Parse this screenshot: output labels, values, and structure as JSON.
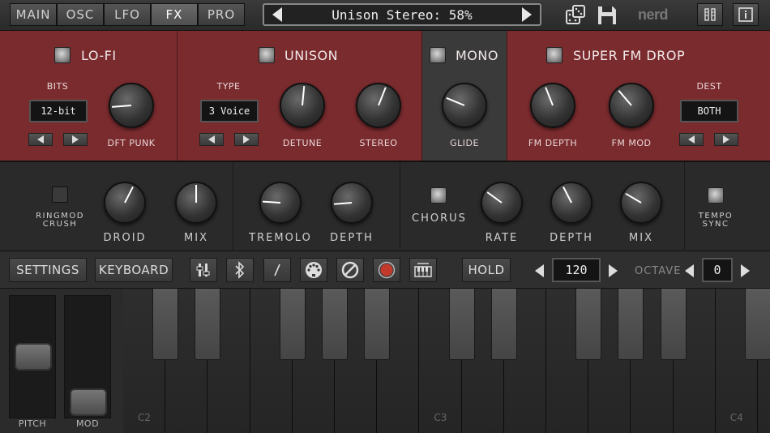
{
  "tabs": [
    {
      "label": "MAIN"
    },
    {
      "label": "OSC"
    },
    {
      "label": "LFO"
    },
    {
      "label": "FX",
      "active": true
    },
    {
      "label": "PRO"
    }
  ],
  "preset": {
    "name": "Unison Stereo: 58%"
  },
  "brand": "nerd",
  "icons": {
    "dice": "dice-icon",
    "save": "floppy-disk-icon",
    "menu": "sliders-menu-icon",
    "info": "info-icon"
  },
  "lofi": {
    "title": "LO-FI",
    "bits_label": "BITS",
    "bits_value": "12-bit",
    "knob_label": "DFT PUNK",
    "knob_value": 0.15
  },
  "unison": {
    "title": "UNISON",
    "type_label": "TYPE",
    "type_value": "3 Voice",
    "detune_label": "DETUNE",
    "detune_value": 0.52,
    "stereo_label": "STEREO",
    "stereo_value": 0.58
  },
  "mono": {
    "title": "MONO",
    "glide_label": "GLIDE",
    "glide_value": 0.25
  },
  "superfm": {
    "title": "SUPER FM DROP",
    "fm_depth_label": "FM DEPTH",
    "fm_depth_value": 0.42,
    "fm_mod_label": "FM MOD",
    "fm_mod_value": 0.35,
    "dest_label": "DEST",
    "dest_value": "BOTH"
  },
  "ringmod": {
    "label_line1": "RINGMOD",
    "label_line2": "CRUSH",
    "droid_label": "DROID",
    "droid_value": 0.6,
    "mix_label": "MIX",
    "mix_value": 0.5
  },
  "tremolo": {
    "tremolo_label": "TREMOLO",
    "tremolo_value": 0.18,
    "depth_label": "DEPTH",
    "depth_value": 0.15
  },
  "chorus": {
    "label": "CHORUS",
    "rate_label": "RATE",
    "rate_value": 0.3,
    "depth_label": "DEPTH",
    "depth_value": 0.4,
    "mix_label": "MIX",
    "mix_value": 0.28
  },
  "temposync": {
    "label_line1": "TEMPO",
    "label_line2": "SYNC"
  },
  "toolbar": {
    "settings_label": "SETTINGS",
    "keyboard_label": "KEYBOARD",
    "hold_label": "HOLD",
    "tempo_value": "120",
    "octave_label": "OCTAVE",
    "octave_value": "0"
  },
  "wheels": {
    "pitch_label": "PITCH",
    "pitch_value": 0.5,
    "mod_label": "MOD",
    "mod_value": 0.0
  },
  "keyboard": {
    "notes": [
      "C2",
      "C3",
      "C4"
    ]
  }
}
